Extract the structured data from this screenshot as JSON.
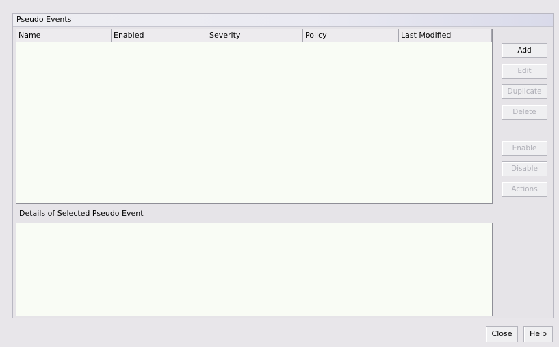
{
  "panel": {
    "title": "Pseudo Events"
  },
  "table": {
    "columns": [
      "Name",
      "Enabled",
      "Severity",
      "Policy",
      "Last Modified"
    ],
    "rows": []
  },
  "details": {
    "label": "Details of Selected Pseudo Event"
  },
  "buttons": {
    "add": "Add",
    "edit": "Edit",
    "duplicate": "Duplicate",
    "delete": "Delete",
    "enable": "Enable",
    "disable": "Disable",
    "actions": "Actions"
  },
  "footer": {
    "close": "Close",
    "help": "Help"
  }
}
